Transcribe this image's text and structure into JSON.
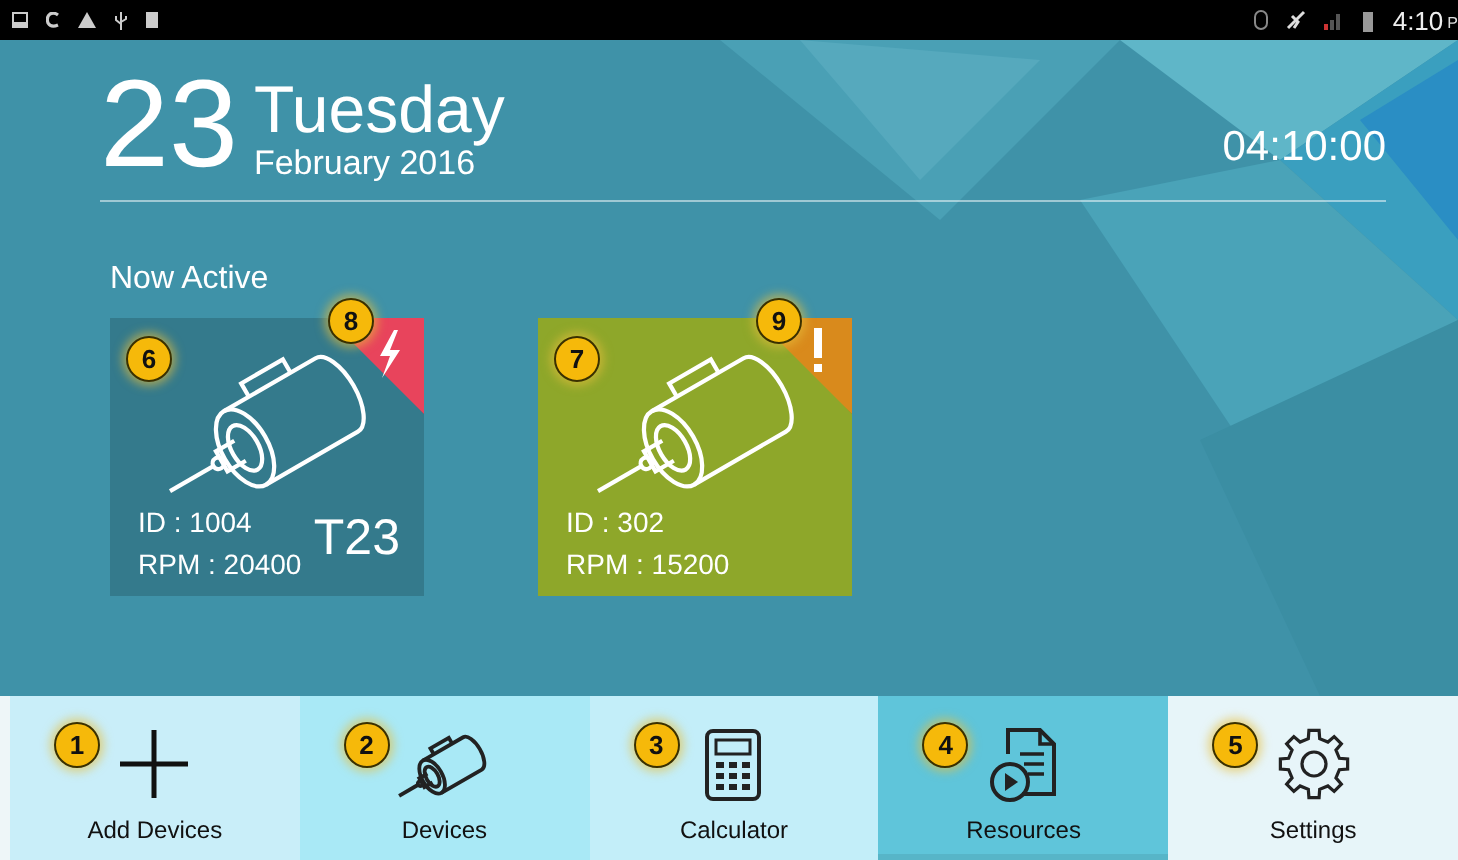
{
  "status_bar": {
    "time": "4:10",
    "meridiem": "P"
  },
  "header": {
    "day": "23",
    "weekday": "Tuesday",
    "month_year": "February 2016",
    "clock": "04:10:00"
  },
  "section_title": "Now Active",
  "devices": [
    {
      "id": "ID : 1004",
      "rpm": "RPM : 20400",
      "tag": "T23",
      "color": "#347a8c",
      "alert": {
        "kind": "power",
        "color": "#e8445c"
      },
      "callout": "6",
      "alert_callout": "8"
    },
    {
      "id": "ID : 302",
      "rpm": "RPM : 15200",
      "color": "#8ea72a",
      "alert": {
        "kind": "warning",
        "color": "#d98a1c"
      },
      "callout": "7",
      "alert_callout": "9"
    }
  ],
  "nav": [
    {
      "kind": "add",
      "label": "Add Devices",
      "selected": false,
      "color": "#c9eef9",
      "callout": "1"
    },
    {
      "kind": "devices",
      "label": "Devices",
      "selected": false,
      "color": "#a9e9f6",
      "callout": "2"
    },
    {
      "kind": "calculator",
      "label": "Calculator",
      "selected": false,
      "color": "#c3eef9",
      "callout": "3"
    },
    {
      "kind": "resources",
      "label": "Resources",
      "selected": true,
      "color": "#5fc5da",
      "callout": "4"
    },
    {
      "kind": "settings",
      "label": "Settings",
      "selected": false,
      "color": "#e7f5f9",
      "callout": "5"
    }
  ]
}
